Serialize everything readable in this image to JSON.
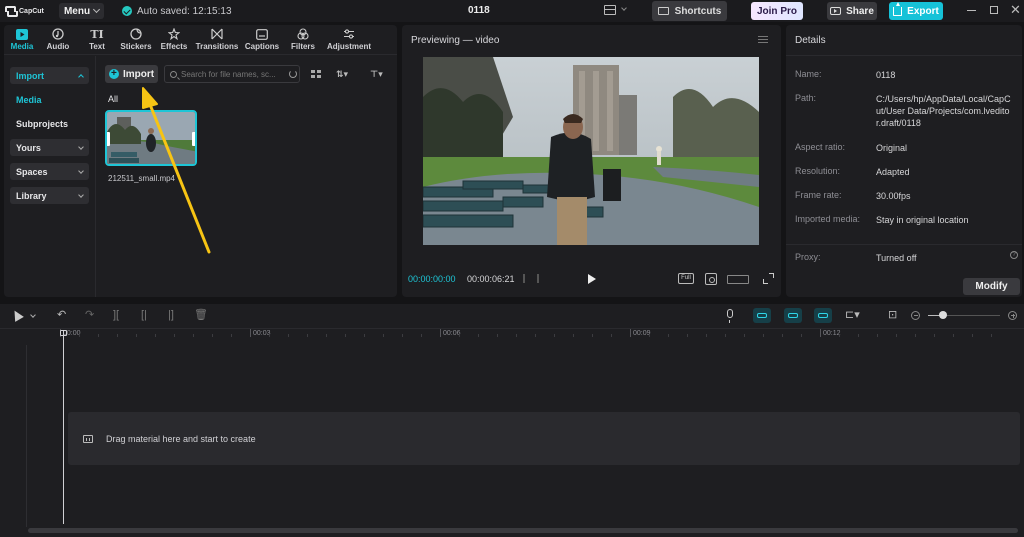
{
  "app": {
    "logo_text": "CapCut",
    "menu_label": "Menu",
    "autosave_text": "Auto saved: 12:15:13",
    "project_title": "0118",
    "shortcuts_label": "Shortcuts",
    "join_pro_label": "Join Pro",
    "share_label": "Share",
    "export_label": "Export",
    "accent_color": "#1ec5d6"
  },
  "tool_tabs": [
    {
      "label": "Media",
      "icon": "media-icon",
      "active": true
    },
    {
      "label": "Audio",
      "icon": "audio-icon"
    },
    {
      "label": "Text",
      "icon": "text-icon"
    },
    {
      "label": "Stickers",
      "icon": "sticker-icon"
    },
    {
      "label": "Effects",
      "icon": "effects-icon"
    },
    {
      "label": "Transitions",
      "icon": "transitions-icon"
    },
    {
      "label": "Captions",
      "icon": "captions-icon"
    },
    {
      "label": "Filters",
      "icon": "filters-icon"
    },
    {
      "label": "Adjustment",
      "icon": "adjustment-icon"
    }
  ],
  "media_sidebar": {
    "import": "Import",
    "media": "Media",
    "subprojects": "Subprojects",
    "yours": "Yours",
    "spaces": "Spaces",
    "library": "Library"
  },
  "media": {
    "import_button": "Import",
    "search_placeholder": "Search for file names, sc...",
    "filter_all": "All",
    "clip_name": "212511_small.mp4"
  },
  "preview": {
    "title": "Previewing — video",
    "current_time": "00:00:00:00",
    "total_time": "00:00:06:21",
    "full_label": "Full"
  },
  "details": {
    "title": "Details",
    "rows": [
      {
        "label": "Name:",
        "value": "0118"
      },
      {
        "label": "Path:",
        "value": "C:/Users/hp/AppData/Local/CapCut/User Data/Projects/com.lveditor.draft/0118"
      },
      {
        "label": "Aspect ratio:",
        "value": "Original"
      },
      {
        "label": "Resolution:",
        "value": "Adapted"
      },
      {
        "label": "Frame rate:",
        "value": "30.00fps"
      },
      {
        "label": "Imported media:",
        "value": "Stay in original location"
      },
      {
        "label": "Proxy:",
        "value": "Turned off"
      }
    ],
    "modify_button": "Modify"
  },
  "timeline": {
    "ruler_labels": [
      "00:00",
      "00:03",
      "00:06",
      "00:09",
      "00:12"
    ],
    "drop_text": "Drag material here and start to create"
  }
}
